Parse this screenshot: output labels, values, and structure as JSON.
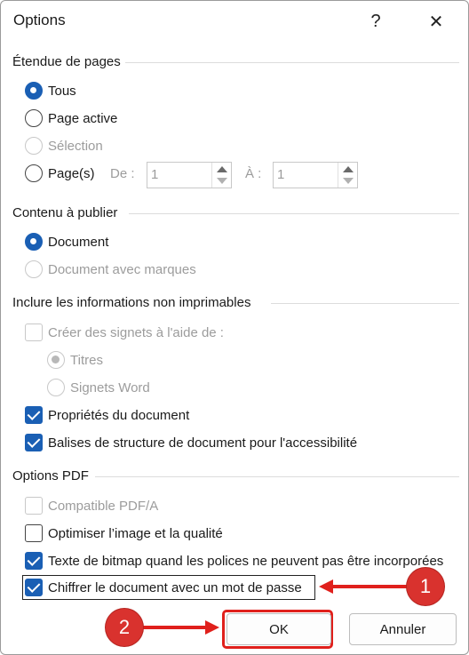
{
  "window": {
    "title": "Options",
    "help_glyph": "?",
    "close_glyph": "✕"
  },
  "page_range": {
    "heading": "Étendue de pages",
    "all": "Tous",
    "current": "Page active",
    "selection": "Sélection",
    "pages": "Page(s)",
    "from_label": "De :",
    "from_value": "1",
    "to_label": "À :",
    "to_value": "1"
  },
  "publish": {
    "heading": "Contenu à publier",
    "document": "Document",
    "document_markup": "Document avec marques"
  },
  "nonprint": {
    "heading": "Inclure les informations non imprimables",
    "bookmarks": "Créer des signets à l'aide de :",
    "headings": "Titres",
    "word_bookmarks": "Signets Word",
    "properties": "Propriétés du document",
    "tags": "Balises de structure de document pour l'accessibilité"
  },
  "pdf": {
    "heading": "Options PDF",
    "pdfa": "Compatible PDF/A",
    "optimize": "Optimiser l’image et la qualité",
    "bitmap": "Texte de bitmap quand les polices ne peuvent pas être incorporées",
    "encrypt": "Chiffrer le document avec un mot de passe"
  },
  "buttons": {
    "ok": "OK",
    "cancel": "Annuler"
  },
  "annotations": {
    "badge1": "1",
    "badge2": "2",
    "accent": "#d9322e"
  }
}
